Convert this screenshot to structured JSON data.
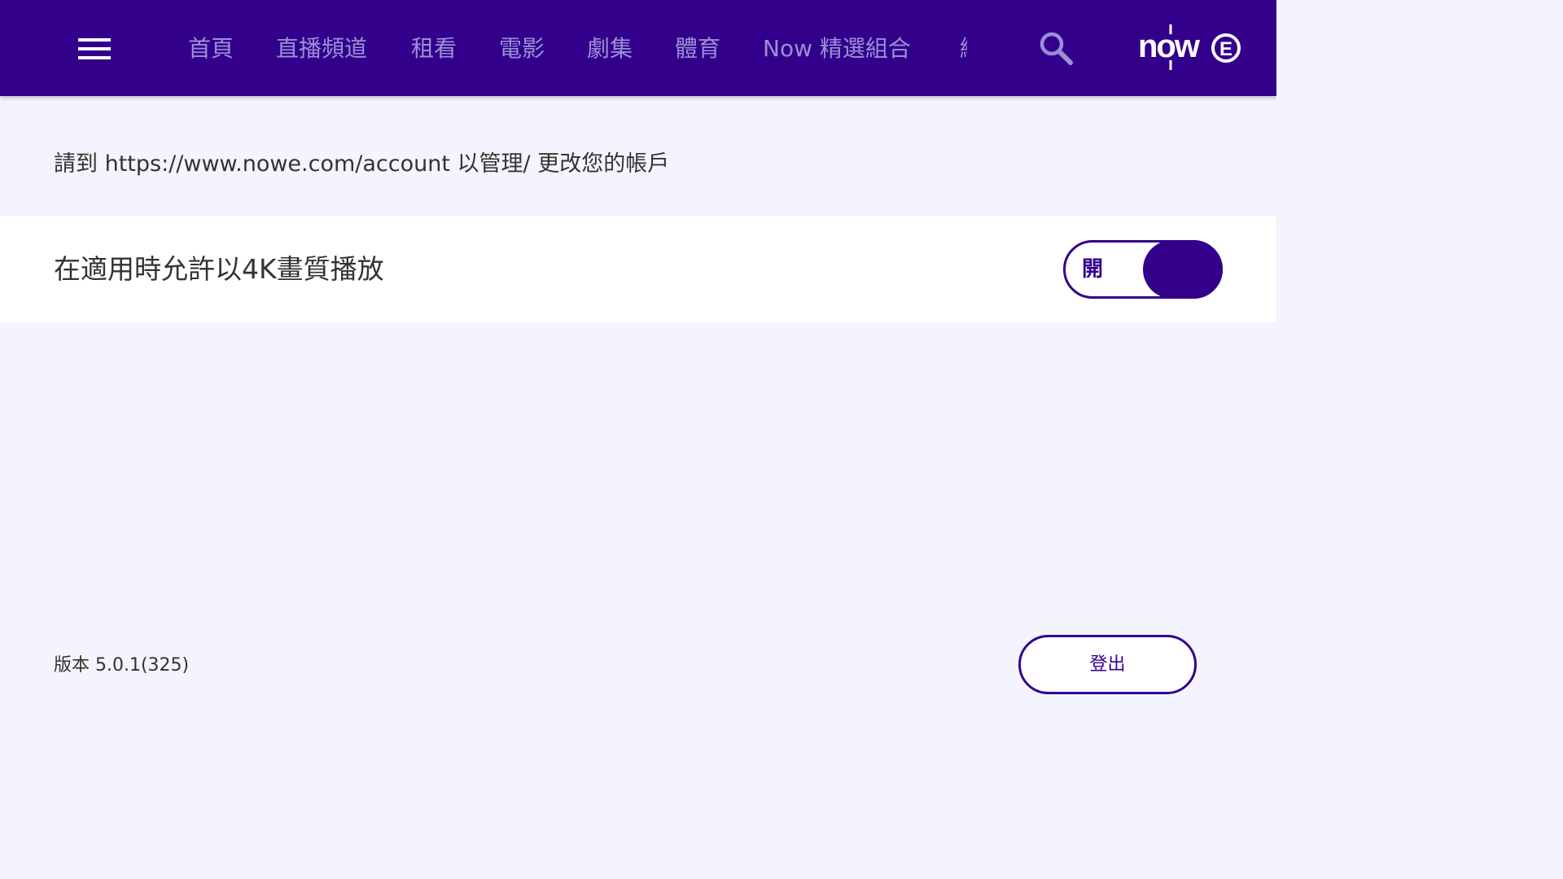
{
  "header": {
    "nav_items": [
      {
        "label": "首頁"
      },
      {
        "label": "直播頻道"
      },
      {
        "label": "租看"
      },
      {
        "label": "電影"
      },
      {
        "label": "劇集"
      },
      {
        "label": "體育"
      },
      {
        "label": "Now 精選組合"
      },
      {
        "label": "綜"
      }
    ],
    "logo_text": "now",
    "logo_badge": "E",
    "menu_icon": "hamburger-menu-icon",
    "search_icon": "search-icon"
  },
  "content": {
    "account_note": "請到 https://www.nowe.com/account 以管理/ 更改您的帳戶",
    "setting_4k_label": "在適用時允許以4K畫質播放",
    "toggle_state_label": "開"
  },
  "footer": {
    "version_text": "版本 5.0.1(325)",
    "logout_label": "登出"
  },
  "colors": {
    "brand_purple": "#33008c",
    "nav_text": "#9b8fd6",
    "page_background": "#f3f4fd",
    "row_background": "#ffffff"
  }
}
